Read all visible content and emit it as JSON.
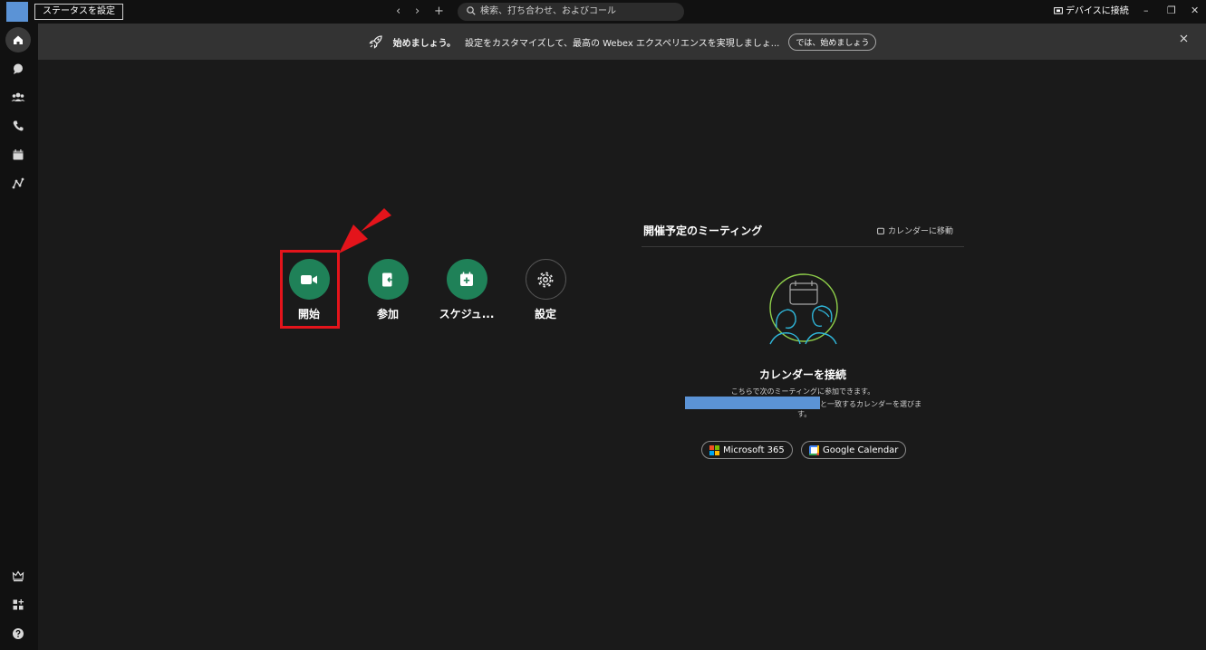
{
  "titlebar": {
    "status_label": "ステータスを設定",
    "nav_back": "‹",
    "nav_forward": "›",
    "nav_new": "+",
    "search_placeholder": "検索、打ち合わせ、およびコール",
    "device_label": "デバイスに接続",
    "minimize": "–",
    "restore": "❐",
    "close": "✕"
  },
  "banner": {
    "headline": "始めましょう。",
    "message": "設定をカスタマイズして、最高の Webex エクスペリエンスを実現しましょ...",
    "button": "では、始めましょう",
    "close": "✕"
  },
  "actions": [
    {
      "label": "開始",
      "icon": "video-icon"
    },
    {
      "label": "参加",
      "icon": "join-icon"
    },
    {
      "label": "スケジュ...",
      "icon": "calendar-add-icon"
    },
    {
      "label": "設定",
      "icon": "gear-icon"
    }
  ],
  "upcoming": {
    "title": "開催予定のミーティング",
    "goto_calendar": "カレンダーに移動",
    "connect_title": "カレンダーを接続",
    "desc_line1": "こちらで次のミーティングに参加できます。",
    "desc_line2": "と一致するカレンダーを選びま",
    "desc_line3": "す。",
    "microsoft_btn": "Microsoft 365",
    "google_btn": "Google Calendar"
  },
  "colors": {
    "accent_green": "#1f8158",
    "highlight_red": "#e4141b",
    "avatar_blue": "#5b93d6"
  }
}
